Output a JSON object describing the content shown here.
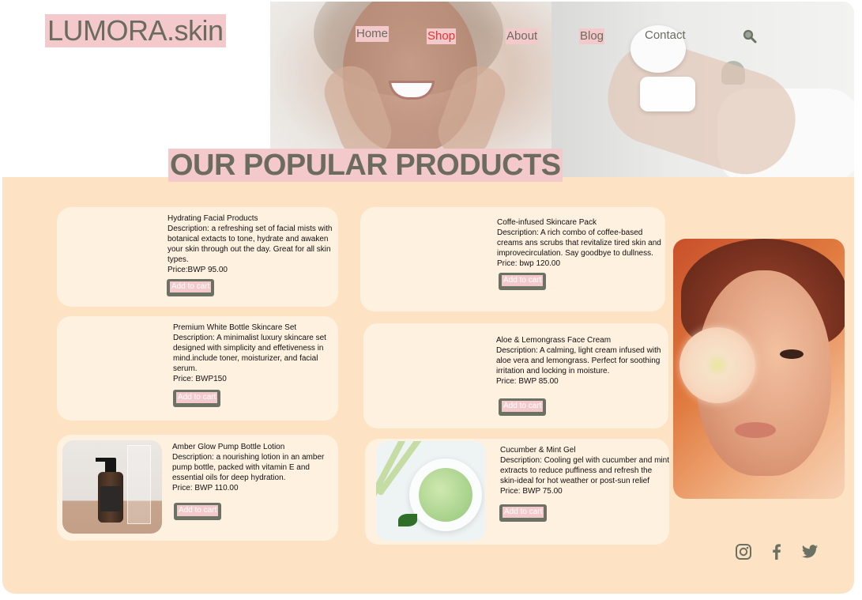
{
  "brand": {
    "logo": "LUMORA.skin"
  },
  "nav": {
    "home": "Home",
    "shop": "Shop",
    "about": "About",
    "blog": "Blog",
    "contact": "Contact",
    "search_icon": "search-icon"
  },
  "section": {
    "title": "OUR POPULAR PRODUCTS"
  },
  "products": [
    {
      "name": "Hydrating Facial Products",
      "description": "Description: a refreshing set of facial mists with botanical extacts to tone, hydrate and awaken your skin through out the day. Great for all skin types.",
      "price": "Price:BWP 95.00",
      "button": "Add to cart"
    },
    {
      "name": "Coffe-infused Skincare Pack",
      "description": "Description: A rich combo of coffee-based creams ans scrubs that revitalize tired skin and improvecirculation. Say goodbye to dullness.",
      "price": "Price: bwp 120.00",
      "button": "Add to cart"
    },
    {
      "name": "Premium White Bottle Skincare Set",
      "description": "Description: A minimalist luxury skincare set designed with simplicity and effetiveness in mind.include toner, moisturizer, and facial serum.",
      "price": "Price: BWP150",
      "button": "Add to cart"
    },
    {
      "name": "Aloe & Lemongrass Face Cream",
      "description": "Description: A calming, light cream infused with aloe vera and lemongrass. Perfect for soothing irritation and locking in moisture.",
      "price": "Price: BWP 85.00",
      "button": "Add to cart"
    },
    {
      "name": "Amber Glow Pump Bottle Lotion",
      "description": "Description: a nourishing lotion in an amber pump bottle, packed with vitamin E and essential oils for deep hydration.",
      "price": "Price: BWP  110.00",
      "button": "Add to cart"
    },
    {
      "name": "Cucumber & Mint Gel",
      "description": "Description: Cooling gel with cucumber and mint extracts to reduce puffiness and refresh the skin-ideal for hot weather or post-sun relief",
      "price": "Price: BWP 75.00",
      "button": "Add to cart"
    }
  ],
  "social": [
    "instagram-icon",
    "facebook-icon",
    "twitter-icon"
  ],
  "colors": {
    "accent_pink": "#f4c9cc",
    "panel_peach": "#fde2c3",
    "card_cream": "#fef1e0",
    "button_olive": "#6b7263",
    "text_gray": "#6b6b60",
    "shop_red": "#e0352f"
  }
}
